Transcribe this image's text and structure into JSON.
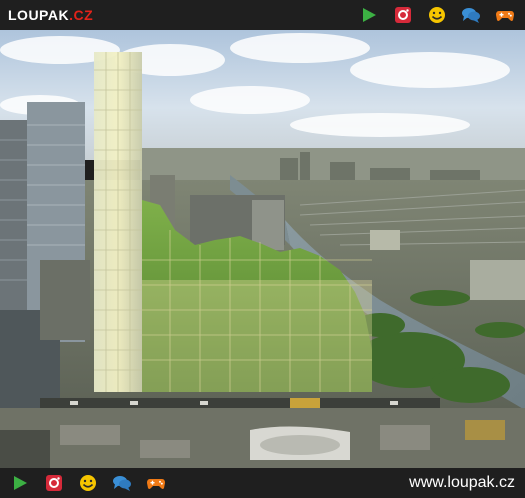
{
  "header": {
    "logo_main": "LOUPAK",
    "logo_dot": ".",
    "logo_tld": "CZ",
    "icons": [
      "play-icon",
      "instagram-icon",
      "smiley-icon",
      "chat-icon",
      "gamepad-icon"
    ]
  },
  "footer": {
    "url": "www.loupak.cz",
    "icons": [
      "play-icon",
      "instagram-icon",
      "smiley-icon",
      "chat-icon",
      "gamepad-icon"
    ]
  },
  "colors": {
    "bar": "#1f1f1f",
    "play": "#3cb043",
    "instagram": "#d62a3a",
    "smiley": "#f6c500",
    "chat": "#3a8fd6",
    "gamepad": "#f07a16",
    "logo_accent": "#e2231a"
  }
}
